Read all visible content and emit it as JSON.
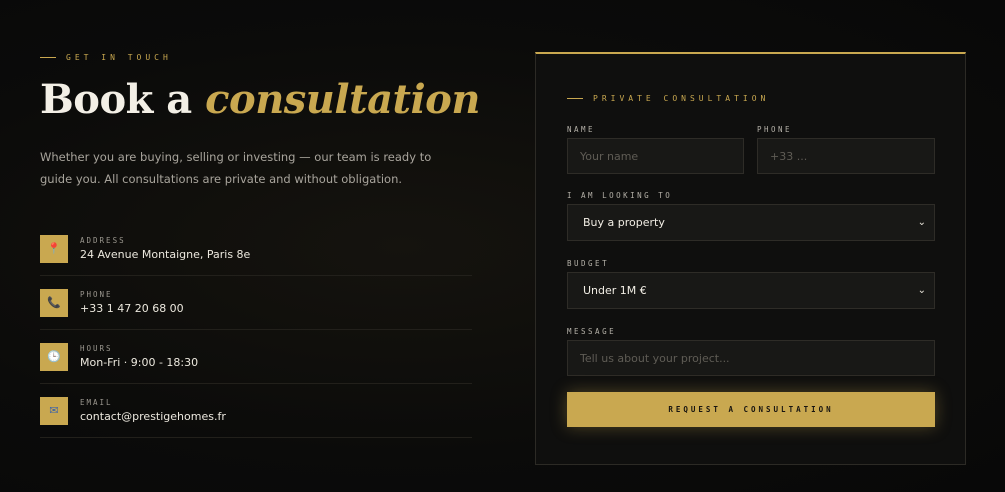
{
  "section": {
    "eyebrow": "GET IN TOUCH",
    "headline_plain": "Book a",
    "headline_accent": "consultation",
    "intro": "Whether you are buying, selling or investing — our team is ready to guide you. All consultations are private and without obligation."
  },
  "contacts": [
    {
      "icon": "pin-icon",
      "label": "ADDRESS",
      "value": "24 Avenue Montaigne, Paris 8e"
    },
    {
      "icon": "phone-icon",
      "label": "PHONE",
      "value": "+33 1 47 20 68 00"
    },
    {
      "icon": "clock-icon",
      "label": "HOURS",
      "value": "Mon-Fri · 9:00 - 18:30"
    },
    {
      "icon": "email-icon",
      "label": "EMAIL",
      "value": "contact@prestigehomes.fr"
    }
  ],
  "form": {
    "eyebrow": "PRIVATE CONSULTATION",
    "name_label": "NAME",
    "name_placeholder": "Your name",
    "phone_label": "PHONE",
    "phone_placeholder": "+33 ...",
    "intent_label": "I AM LOOKING TO",
    "intent_value": "Buy a property",
    "budget_label": "BUDGET",
    "budget_value": "Under 1M €",
    "message_label": "MESSAGE",
    "message_placeholder": "Tell us about your project...",
    "submit_label": "REQUEST A CONSULTATION"
  },
  "colors": {
    "accent": "#c9a850",
    "background": "#0b0b0a"
  }
}
